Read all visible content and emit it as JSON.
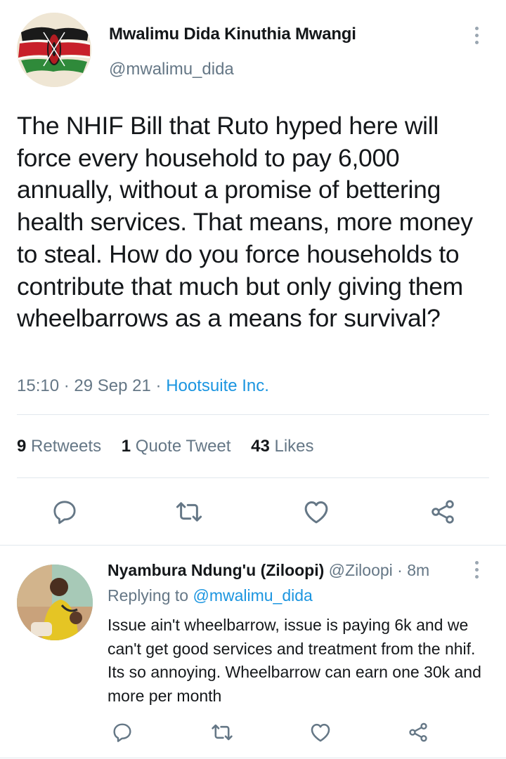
{
  "tweet": {
    "author_name": "Mwalimu Dida Kinuthia Mwangi",
    "handle": "@mwalimu_dida",
    "text": "The NHIF Bill that Ruto hyped here will force every household to pay 6,000 annually, without a promise of bettering health services. That means, more money to steal. How do you force households to contribute that much but only giving them wheelbarrows as a means for survival?",
    "time": "15:10",
    "date": "29 Sep 21",
    "source": "Hootsuite Inc.",
    "separator": "·",
    "stats": {
      "retweets_count": "9",
      "retweets_label": "Retweets",
      "quotes_count": "1",
      "quotes_label": "Quote Tweet",
      "likes_count": "43",
      "likes_label": "Likes"
    }
  },
  "reply": {
    "author_name": "Nyambura Ndung'u (Ziloopi)",
    "handle": "@Ziloopi",
    "time": "8m",
    "replying_prefix": "Replying to",
    "replying_to": "@mwalimu_dida",
    "text": "Issue ain't wheelbarrow, issue is paying 6k and we can't get good services and treatment from the nhif. Its so annoying. Wheelbarrow can earn one 30k and more per month"
  },
  "icons": [
    "more-vertical-icon",
    "reply-icon",
    "retweet-icon",
    "like-icon",
    "share-icon"
  ],
  "colors": {
    "text": "#14171a",
    "secondary": "#657786",
    "link": "#1b95e0",
    "divider": "#e1e8ed",
    "icon": "#657786"
  }
}
